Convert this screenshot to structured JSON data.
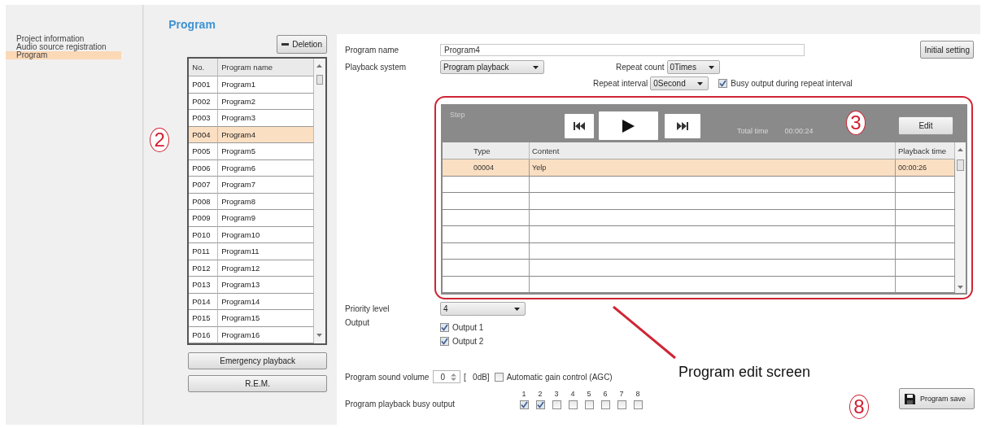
{
  "sidebar": {
    "items": [
      {
        "label": "Project information",
        "selected": false
      },
      {
        "label": "Audio source registration",
        "selected": false
      },
      {
        "label": "Program",
        "selected": true
      }
    ]
  },
  "program_panel": {
    "title": "Program",
    "delete_button": "Deletion",
    "columns": [
      "No.",
      "Program name"
    ],
    "rows": [
      {
        "no": "P001",
        "name": "Program1",
        "selected": false
      },
      {
        "no": "P002",
        "name": "Program2",
        "selected": false
      },
      {
        "no": "P003",
        "name": "Program3",
        "selected": false
      },
      {
        "no": "P004",
        "name": "Program4",
        "selected": true
      },
      {
        "no": "P005",
        "name": "Program5",
        "selected": false
      },
      {
        "no": "P006",
        "name": "Program6",
        "selected": false
      },
      {
        "no": "P007",
        "name": "Program7",
        "selected": false
      },
      {
        "no": "P008",
        "name": "Program8",
        "selected": false
      },
      {
        "no": "P009",
        "name": "Program9",
        "selected": false
      },
      {
        "no": "P010",
        "name": "Program10",
        "selected": false
      },
      {
        "no": "P011",
        "name": "Program11",
        "selected": false
      },
      {
        "no": "P012",
        "name": "Program12",
        "selected": false
      },
      {
        "no": "P013",
        "name": "Program13",
        "selected": false
      },
      {
        "no": "P014",
        "name": "Program14",
        "selected": false
      },
      {
        "no": "P015",
        "name": "Program15",
        "selected": false
      },
      {
        "no": "P016",
        "name": "Program16",
        "selected": false
      }
    ],
    "buttons": [
      "Emergency playback",
      "R.E.M."
    ]
  },
  "editor": {
    "program_name": {
      "label": "Program name",
      "value": "Program4"
    },
    "initial_setting_button": "Initial setting",
    "playback_system": {
      "label": "Playback system",
      "value": "Program playback"
    },
    "repeat_count": {
      "label": "Repeat count",
      "value": "0Times"
    },
    "repeat_interval": {
      "label": "Repeat interval",
      "value": "0Second"
    },
    "busy_during_interval": {
      "label": "Busy output during repeat interval",
      "checked": true
    },
    "step_panel": {
      "title": "Step",
      "total_time_label": "Total time",
      "total_time": "00:00:24",
      "edit_button": "Edit",
      "columns": [
        "Type",
        "Content",
        "Playback time"
      ],
      "rows": [
        {
          "type": "00004",
          "content": "Yelp",
          "time": "00:00:26",
          "selected": true
        }
      ]
    },
    "priority_level": {
      "label": "Priority level",
      "value": "4"
    },
    "output": {
      "label": "Output",
      "options": [
        {
          "label": "Output 1",
          "checked": true
        },
        {
          "label": "Output 2",
          "checked": true
        }
      ]
    },
    "sound_volume": {
      "label": "Program sound volume",
      "value": "0",
      "reading": "[   0dB]"
    },
    "agc": {
      "label": "Automatic gain control (AGC)",
      "checked": false
    },
    "busy_output": {
      "label": "Program playback busy output",
      "channels": [
        {
          "number": "1",
          "checked": true
        },
        {
          "number": "2",
          "checked": true
        },
        {
          "number": "3",
          "checked": false
        },
        {
          "number": "4",
          "checked": false
        },
        {
          "number": "5",
          "checked": false
        },
        {
          "number": "6",
          "checked": false
        },
        {
          "number": "7",
          "checked": false
        },
        {
          "number": "8",
          "checked": false
        }
      ]
    },
    "save_button": "Program save"
  },
  "annotations": {
    "callouts": [
      "2",
      "3",
      "8"
    ],
    "caption": "Program edit screen"
  }
}
